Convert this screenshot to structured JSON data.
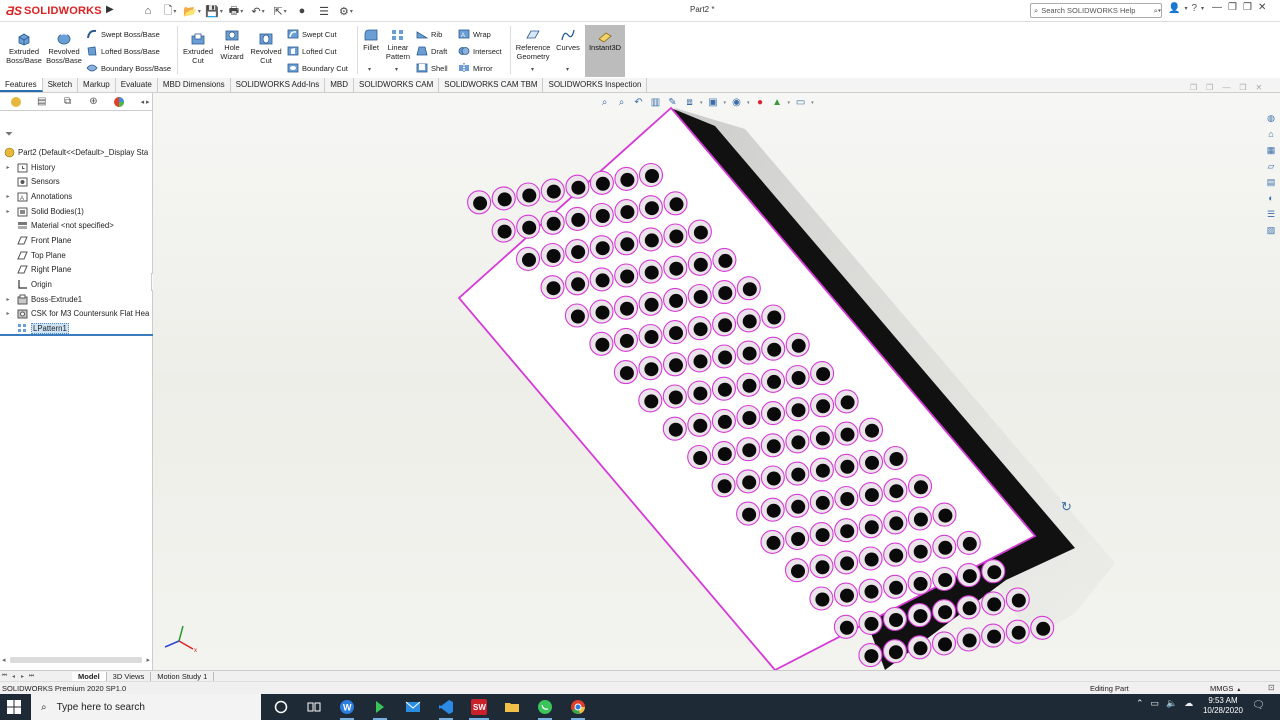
{
  "app": {
    "logo_text": "SOLIDWORKS",
    "document_title": "Part2 *",
    "search_placeholder": "Search SOLIDWORKS Help"
  },
  "quick_access": [
    "home-icon",
    "new-icon",
    "open-icon",
    "save-icon",
    "print-icon",
    "undo-icon",
    "select-icon",
    "rebuild-icon",
    "file-properties-icon",
    "options-icon"
  ],
  "command_manager": {
    "extruded_boss": "Extruded\nBoss/Base",
    "revolved_boss": "Revolved\nBoss/Base",
    "swept_boss": "Swept Boss/Base",
    "lofted_boss": "Lofted Boss/Base",
    "boundary_boss": "Boundary Boss/Base",
    "extruded_cut": "Extruded\nCut",
    "hole_wizard": "Hole\nWizard",
    "revolved_cut": "Revolved\nCut",
    "swept_cut": "Swept Cut",
    "lofted_cut": "Lofted Cut",
    "boundary_cut": "Boundary Cut",
    "fillet": "Fillet",
    "linear_pattern": "Linear\nPattern",
    "rib": "Rib",
    "draft": "Draft",
    "shell": "Shell",
    "wrap": "Wrap",
    "intersect": "Intersect",
    "mirror": "Mirror",
    "reference_geometry": "Reference\nGeometry",
    "curves": "Curves",
    "instant3d": "Instant3D"
  },
  "tabs": [
    "Features",
    "Sketch",
    "Markup",
    "Evaluate",
    "MBD Dimensions",
    "SOLIDWORKS Add-Ins",
    "MBD",
    "SOLIDWORKS CAM",
    "SOLIDWORKS CAM TBM",
    "SOLIDWORKS Inspection"
  ],
  "active_tab": "Features",
  "feature_tree": {
    "root": "Part2  (Default<<Default>_Display Sta",
    "items": [
      {
        "label": "History",
        "icon": "history-folder-icon",
        "expand": true
      },
      {
        "label": "Sensors",
        "icon": "sensors-folder-icon",
        "expand": false
      },
      {
        "label": "Annotations",
        "icon": "annotations-folder-icon",
        "expand": true
      },
      {
        "label": "Solid Bodies(1)",
        "icon": "solid-bodies-folder-icon",
        "expand": true
      },
      {
        "label": "Material <not specified>",
        "icon": "material-icon",
        "expand": false
      },
      {
        "label": "Front Plane",
        "icon": "plane-icon",
        "expand": false
      },
      {
        "label": "Top Plane",
        "icon": "plane-icon",
        "expand": false
      },
      {
        "label": "Right Plane",
        "icon": "plane-icon",
        "expand": false
      },
      {
        "label": "Origin",
        "icon": "origin-icon",
        "expand": false
      },
      {
        "label": "Boss-Extrude1",
        "icon": "extrude-feature-icon",
        "expand": true
      },
      {
        "label": "CSK for M3 Countersunk Flat Hea",
        "icon": "hole-feature-icon",
        "expand": true
      },
      {
        "label": "LPattern1",
        "icon": "linear-pattern-icon",
        "expand": false,
        "selected": true
      }
    ]
  },
  "bottom_tabs": [
    "Model",
    "3D Views",
    "Motion Study 1"
  ],
  "active_bottom_tab": "Model",
  "status": {
    "product": "SOLIDWORKS Premium 2020 SP1.0",
    "mode": "Editing Part",
    "units": "MMGS"
  },
  "taskbar": {
    "search_placeholder": "Type here to search",
    "apps": [
      "cortana-icon",
      "task-view-icon",
      "browser-w-icon",
      "media-arrow-icon",
      "mail-icon",
      "vscode-icon",
      "solidworks-icon",
      "file-explorer-icon",
      "whatsapp-icon",
      "chrome-icon"
    ],
    "time": "9:53 AM",
    "date": "10/28/2020"
  },
  "model": {
    "hole_rows": 8,
    "hole_cols": 17,
    "highlight_color": "#d63ad6",
    "face_color": "#ffffff",
    "side_color": "#111111"
  }
}
